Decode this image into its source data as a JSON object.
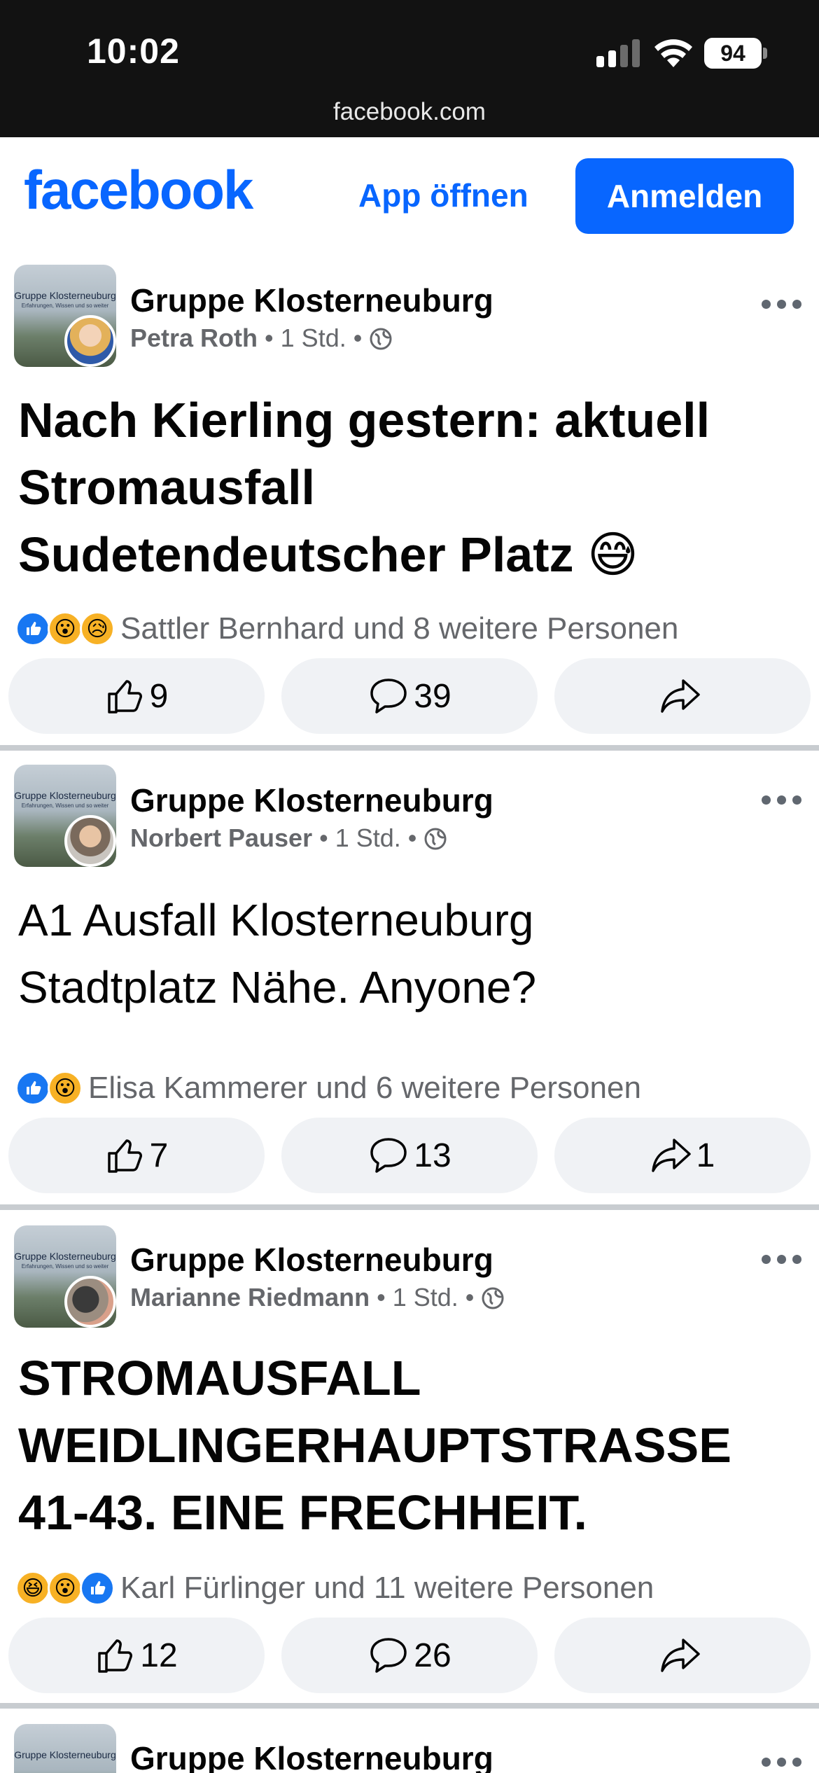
{
  "status_bar": {
    "time": "10:02",
    "battery": "94",
    "url": "facebook.com"
  },
  "header": {
    "logo": "facebook",
    "open_app": "App öffnen",
    "login": "Anmelden"
  },
  "colors": {
    "brand_blue": "#0866ff",
    "like_blue": "#1877f2",
    "meta_gray": "#65676b",
    "pill_bg": "#f0f2f5"
  },
  "posts": [
    {
      "group": "Gruppe Klosterneuburg",
      "avatar_text": "Gruppe Klosterneuburg",
      "avatar_sub": "Erfahrungen, Wissen und so weiter",
      "author": "Petra Roth",
      "time": "1 Std.",
      "text": "Nach Kierling gestern: aktuell\nStromausfall\nSudetendeutscher Platz 😅",
      "reaction_icons": [
        "like-icon",
        "wow-icon",
        "sad-icon"
      ],
      "reactions_summary": "Sattler Bernhard und 8 weitere Personen",
      "likes": "9",
      "comments": "39",
      "shares": ""
    },
    {
      "group": "Gruppe Klosterneuburg",
      "avatar_text": "Gruppe Klosterneuburg",
      "avatar_sub": "Erfahrungen, Wissen und so weiter",
      "author": "Norbert Pauser",
      "time": "1 Std.",
      "text": "A1 Ausfall Klosterneuburg\nStadtplatz Nähe. Anyone?",
      "reaction_icons": [
        "like-icon",
        "wow-icon"
      ],
      "reactions_summary": "Elisa Kammerer und 6 weitere Personen",
      "likes": "7",
      "comments": "13",
      "shares": "1"
    },
    {
      "group": "Gruppe Klosterneuburg",
      "avatar_text": "Gruppe Klosterneuburg",
      "avatar_sub": "Erfahrungen, Wissen und so weiter",
      "author": "Marianne Riedmann",
      "time": "1 Std.",
      "text": "STROMAUSFALL\nWEIDLINGERHAUPTSTRASSE\n41-43. EINE FRECHHEIT.",
      "reaction_icons": [
        "haha-icon",
        "wow-icon",
        "like-icon"
      ],
      "reactions_summary": "Karl Fürlinger und 11 weitere Personen",
      "likes": "12",
      "comments": "26",
      "shares": ""
    },
    {
      "group": "Gruppe Klosterneuburg",
      "avatar_text": "Gruppe Klosterneuburg"
    }
  ]
}
